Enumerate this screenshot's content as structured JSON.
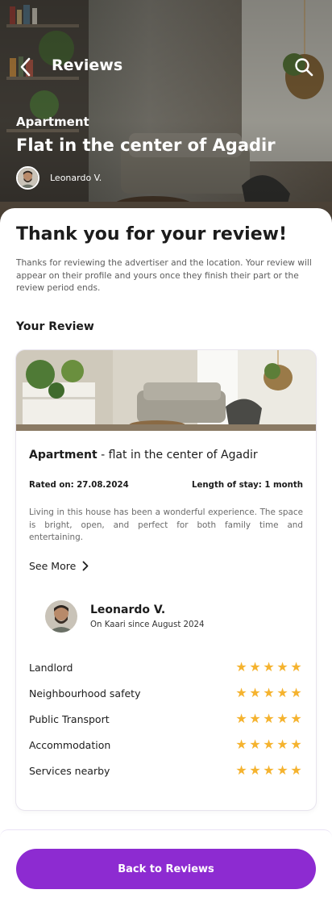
{
  "header": {
    "title": "Reviews",
    "back_icon": "chevron-left-icon",
    "search_icon": "search-icon"
  },
  "listing": {
    "category": "Apartment",
    "title": "Flat in the center of Agadir",
    "author": "Leonardo V."
  },
  "confirmation": {
    "title": "Thank you for your review!",
    "text": "Thanks for reviewing the advertiser and the location. Your review will appear on their profile and yours once they finish their part or the review period ends."
  },
  "your_review": {
    "heading": "Your Review",
    "title_bold": "Apartment",
    "title_rest": " - flat in the center of Agadir",
    "rated_on": "Rated on: 27.08.2024",
    "length_of_stay": "Length of stay: 1 month",
    "text": "Living in this house has been a wonderful experience. The space is bright, open, and perfect for both family time and entertaining.",
    "see_more": "See More",
    "reviewer": {
      "name": "Leonardo V.",
      "since": "On Kaari since August 2024"
    },
    "ratings": [
      {
        "label": "Landlord",
        "stars": 5
      },
      {
        "label": "Neighbourhood safety",
        "stars": 5
      },
      {
        "label": "Public Transport",
        "stars": 5
      },
      {
        "label": "Accommodation",
        "stars": 5
      },
      {
        "label": "Services nearby",
        "stars": 5
      }
    ]
  },
  "footer": {
    "button_label": "Back to Reviews"
  },
  "colors": {
    "accent": "#8d2bd1",
    "star": "#f5b32f",
    "text": "#1c1c1c"
  }
}
